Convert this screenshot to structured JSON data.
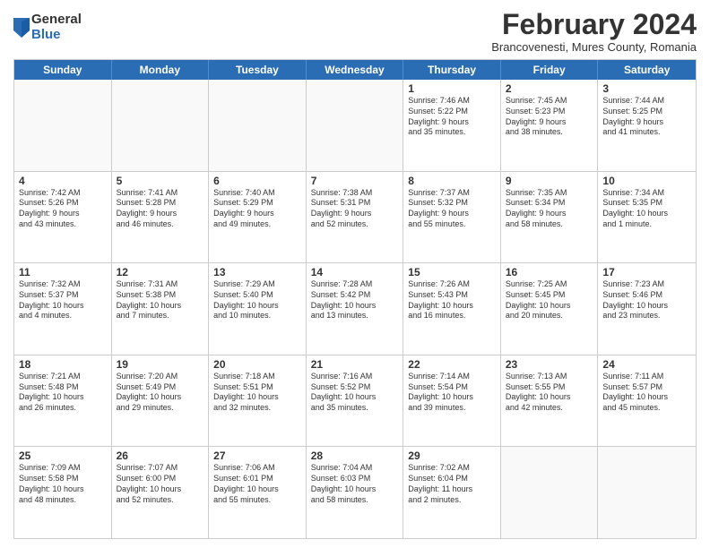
{
  "logo": {
    "general": "General",
    "blue": "Blue"
  },
  "title": "February 2024",
  "location": "Brancovenesti, Mures County, Romania",
  "header_days": [
    "Sunday",
    "Monday",
    "Tuesday",
    "Wednesday",
    "Thursday",
    "Friday",
    "Saturday"
  ],
  "weeks": [
    [
      {
        "day": "",
        "lines": []
      },
      {
        "day": "",
        "lines": []
      },
      {
        "day": "",
        "lines": []
      },
      {
        "day": "",
        "lines": []
      },
      {
        "day": "1",
        "lines": [
          "Sunrise: 7:46 AM",
          "Sunset: 5:22 PM",
          "Daylight: 9 hours",
          "and 35 minutes."
        ]
      },
      {
        "day": "2",
        "lines": [
          "Sunrise: 7:45 AM",
          "Sunset: 5:23 PM",
          "Daylight: 9 hours",
          "and 38 minutes."
        ]
      },
      {
        "day": "3",
        "lines": [
          "Sunrise: 7:44 AM",
          "Sunset: 5:25 PM",
          "Daylight: 9 hours",
          "and 41 minutes."
        ]
      }
    ],
    [
      {
        "day": "4",
        "lines": [
          "Sunrise: 7:42 AM",
          "Sunset: 5:26 PM",
          "Daylight: 9 hours",
          "and 43 minutes."
        ]
      },
      {
        "day": "5",
        "lines": [
          "Sunrise: 7:41 AM",
          "Sunset: 5:28 PM",
          "Daylight: 9 hours",
          "and 46 minutes."
        ]
      },
      {
        "day": "6",
        "lines": [
          "Sunrise: 7:40 AM",
          "Sunset: 5:29 PM",
          "Daylight: 9 hours",
          "and 49 minutes."
        ]
      },
      {
        "day": "7",
        "lines": [
          "Sunrise: 7:38 AM",
          "Sunset: 5:31 PM",
          "Daylight: 9 hours",
          "and 52 minutes."
        ]
      },
      {
        "day": "8",
        "lines": [
          "Sunrise: 7:37 AM",
          "Sunset: 5:32 PM",
          "Daylight: 9 hours",
          "and 55 minutes."
        ]
      },
      {
        "day": "9",
        "lines": [
          "Sunrise: 7:35 AM",
          "Sunset: 5:34 PM",
          "Daylight: 9 hours",
          "and 58 minutes."
        ]
      },
      {
        "day": "10",
        "lines": [
          "Sunrise: 7:34 AM",
          "Sunset: 5:35 PM",
          "Daylight: 10 hours",
          "and 1 minute."
        ]
      }
    ],
    [
      {
        "day": "11",
        "lines": [
          "Sunrise: 7:32 AM",
          "Sunset: 5:37 PM",
          "Daylight: 10 hours",
          "and 4 minutes."
        ]
      },
      {
        "day": "12",
        "lines": [
          "Sunrise: 7:31 AM",
          "Sunset: 5:38 PM",
          "Daylight: 10 hours",
          "and 7 minutes."
        ]
      },
      {
        "day": "13",
        "lines": [
          "Sunrise: 7:29 AM",
          "Sunset: 5:40 PM",
          "Daylight: 10 hours",
          "and 10 minutes."
        ]
      },
      {
        "day": "14",
        "lines": [
          "Sunrise: 7:28 AM",
          "Sunset: 5:42 PM",
          "Daylight: 10 hours",
          "and 13 minutes."
        ]
      },
      {
        "day": "15",
        "lines": [
          "Sunrise: 7:26 AM",
          "Sunset: 5:43 PM",
          "Daylight: 10 hours",
          "and 16 minutes."
        ]
      },
      {
        "day": "16",
        "lines": [
          "Sunrise: 7:25 AM",
          "Sunset: 5:45 PM",
          "Daylight: 10 hours",
          "and 20 minutes."
        ]
      },
      {
        "day": "17",
        "lines": [
          "Sunrise: 7:23 AM",
          "Sunset: 5:46 PM",
          "Daylight: 10 hours",
          "and 23 minutes."
        ]
      }
    ],
    [
      {
        "day": "18",
        "lines": [
          "Sunrise: 7:21 AM",
          "Sunset: 5:48 PM",
          "Daylight: 10 hours",
          "and 26 minutes."
        ]
      },
      {
        "day": "19",
        "lines": [
          "Sunrise: 7:20 AM",
          "Sunset: 5:49 PM",
          "Daylight: 10 hours",
          "and 29 minutes."
        ]
      },
      {
        "day": "20",
        "lines": [
          "Sunrise: 7:18 AM",
          "Sunset: 5:51 PM",
          "Daylight: 10 hours",
          "and 32 minutes."
        ]
      },
      {
        "day": "21",
        "lines": [
          "Sunrise: 7:16 AM",
          "Sunset: 5:52 PM",
          "Daylight: 10 hours",
          "and 35 minutes."
        ]
      },
      {
        "day": "22",
        "lines": [
          "Sunrise: 7:14 AM",
          "Sunset: 5:54 PM",
          "Daylight: 10 hours",
          "and 39 minutes."
        ]
      },
      {
        "day": "23",
        "lines": [
          "Sunrise: 7:13 AM",
          "Sunset: 5:55 PM",
          "Daylight: 10 hours",
          "and 42 minutes."
        ]
      },
      {
        "day": "24",
        "lines": [
          "Sunrise: 7:11 AM",
          "Sunset: 5:57 PM",
          "Daylight: 10 hours",
          "and 45 minutes."
        ]
      }
    ],
    [
      {
        "day": "25",
        "lines": [
          "Sunrise: 7:09 AM",
          "Sunset: 5:58 PM",
          "Daylight: 10 hours",
          "and 48 minutes."
        ]
      },
      {
        "day": "26",
        "lines": [
          "Sunrise: 7:07 AM",
          "Sunset: 6:00 PM",
          "Daylight: 10 hours",
          "and 52 minutes."
        ]
      },
      {
        "day": "27",
        "lines": [
          "Sunrise: 7:06 AM",
          "Sunset: 6:01 PM",
          "Daylight: 10 hours",
          "and 55 minutes."
        ]
      },
      {
        "day": "28",
        "lines": [
          "Sunrise: 7:04 AM",
          "Sunset: 6:03 PM",
          "Daylight: 10 hours",
          "and 58 minutes."
        ]
      },
      {
        "day": "29",
        "lines": [
          "Sunrise: 7:02 AM",
          "Sunset: 6:04 PM",
          "Daylight: 11 hours",
          "and 2 minutes."
        ]
      },
      {
        "day": "",
        "lines": []
      },
      {
        "day": "",
        "lines": []
      }
    ]
  ]
}
